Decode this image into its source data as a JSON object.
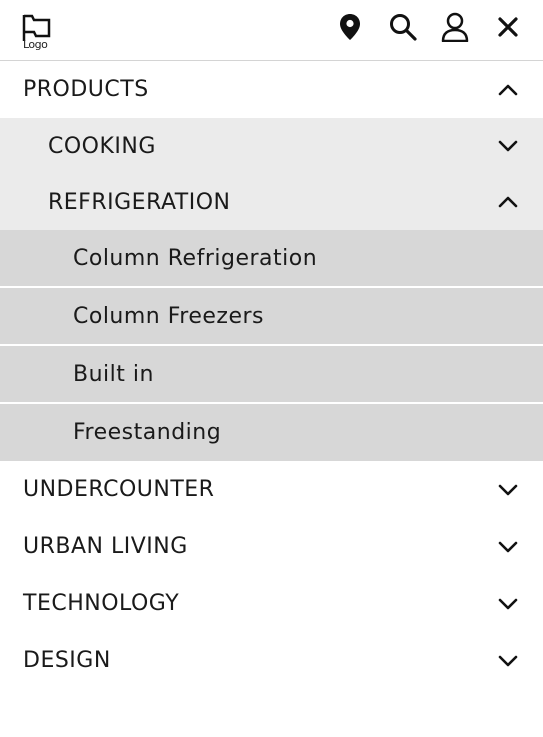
{
  "header": {
    "logo_text": "Logo",
    "icons": [
      "location-pin-icon",
      "search-icon",
      "user-icon",
      "close-icon"
    ]
  },
  "menu": {
    "products": "PRODUCTS",
    "cooking": "COOKING",
    "refrigeration": "REFRIGERATION",
    "refrigeration_items": [
      "Column Refrigeration",
      "Column Freezers",
      "Built in",
      "Freestanding"
    ],
    "undercounter": "UNDERCOUNTER",
    "urban_living": "URBAN LIVING",
    "technology": "TECHNOLOGY",
    "design": "DESIGN"
  },
  "colors": {
    "level2_bg": "#ebebeb",
    "level3_bg": "#d7d7d7",
    "text": "#1a1a1a"
  }
}
